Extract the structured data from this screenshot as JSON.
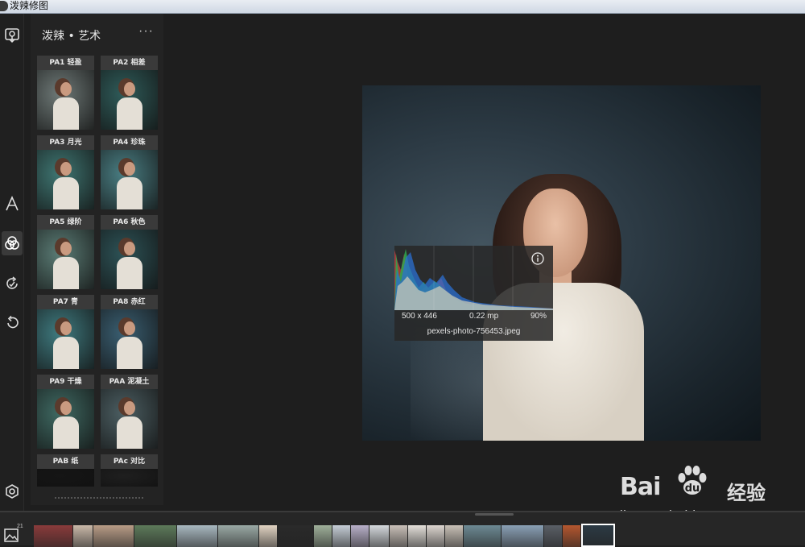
{
  "window": {
    "title": "泼辣修图"
  },
  "toolbar": {
    "tools": [
      {
        "name": "import-icon"
      },
      {
        "name": "text-icon"
      },
      {
        "name": "filters-icon",
        "active": true
      },
      {
        "name": "retouch-icon"
      },
      {
        "name": "undo-icon"
      },
      {
        "name": "settings-icon"
      }
    ]
  },
  "panel": {
    "title": "泼辣 • 艺术",
    "more": "···",
    "presets": [
      {
        "label": "PA1 轻盈",
        "tone": "#6f7a78"
      },
      {
        "label": "PA2 相差",
        "tone": "#2f5c5a"
      },
      {
        "label": "PA3 月光",
        "tone": "#3f7773"
      },
      {
        "label": "PA4 珍珠",
        "tone": "#4a7f84"
      },
      {
        "label": "PA5 绿阶",
        "tone": "#5b7d76"
      },
      {
        "label": "PA6 秋色",
        "tone": "#2d5357"
      },
      {
        "label": "PA7 青",
        "tone": "#3f7b80"
      },
      {
        "label": "PA8 赤红",
        "tone": "#3a5f72"
      },
      {
        "label": "PA9 干燥",
        "tone": "#3f6a63"
      },
      {
        "label": "PAA 泥凝土",
        "tone": "#4c5f63"
      },
      {
        "label": "PAB 纸",
        "tone": "#151515"
      },
      {
        "label": "PAc 对比",
        "tone": "#1f1f1f"
      }
    ]
  },
  "histogram": {
    "dimensions": "500 x 446",
    "megapixels": "0.22 mp",
    "zoom": "90%",
    "filename": "pexels-photo-756453.jpeg"
  },
  "watermark": {
    "logo": "Bai",
    "logo_suffix": "经验",
    "url": "jingyan.baidu.com"
  },
  "filmstrip": {
    "count": "21",
    "thumbs": [
      {
        "color": "#8a3b3b",
        "w": 48
      },
      {
        "color": "#c9b8a8",
        "w": 24
      },
      {
        "color": "#b89c86",
        "w": 50
      },
      {
        "color": "#5d7a5a",
        "w": 52
      },
      {
        "color": "#a8b8c0",
        "w": 50
      },
      {
        "color": "#9aa9a5",
        "w": 50
      },
      {
        "color": "#e1d3c2",
        "w": 22
      },
      {
        "color": "#2a2a2a",
        "w": 44
      },
      {
        "color": "#9fb09a",
        "w": 22
      },
      {
        "color": "#c5cdd6",
        "w": 22
      },
      {
        "color": "#b8b0c9",
        "w": 22
      },
      {
        "color": "#d4d8dc",
        "w": 24
      },
      {
        "color": "#c9c0b8",
        "w": 22
      },
      {
        "color": "#e3dfd9",
        "w": 22
      },
      {
        "color": "#dcd5cf",
        "w": 22
      },
      {
        "color": "#c8c0b6",
        "w": 22
      },
      {
        "color": "#6d8a94",
        "w": 46
      },
      {
        "color": "#8aa0b5",
        "w": 52
      },
      {
        "color": "#5a5f66",
        "w": 22
      },
      {
        "color": "#b4572f",
        "w": 22
      },
      {
        "color": "#2c3a44",
        "w": 42,
        "selected": true
      }
    ]
  }
}
